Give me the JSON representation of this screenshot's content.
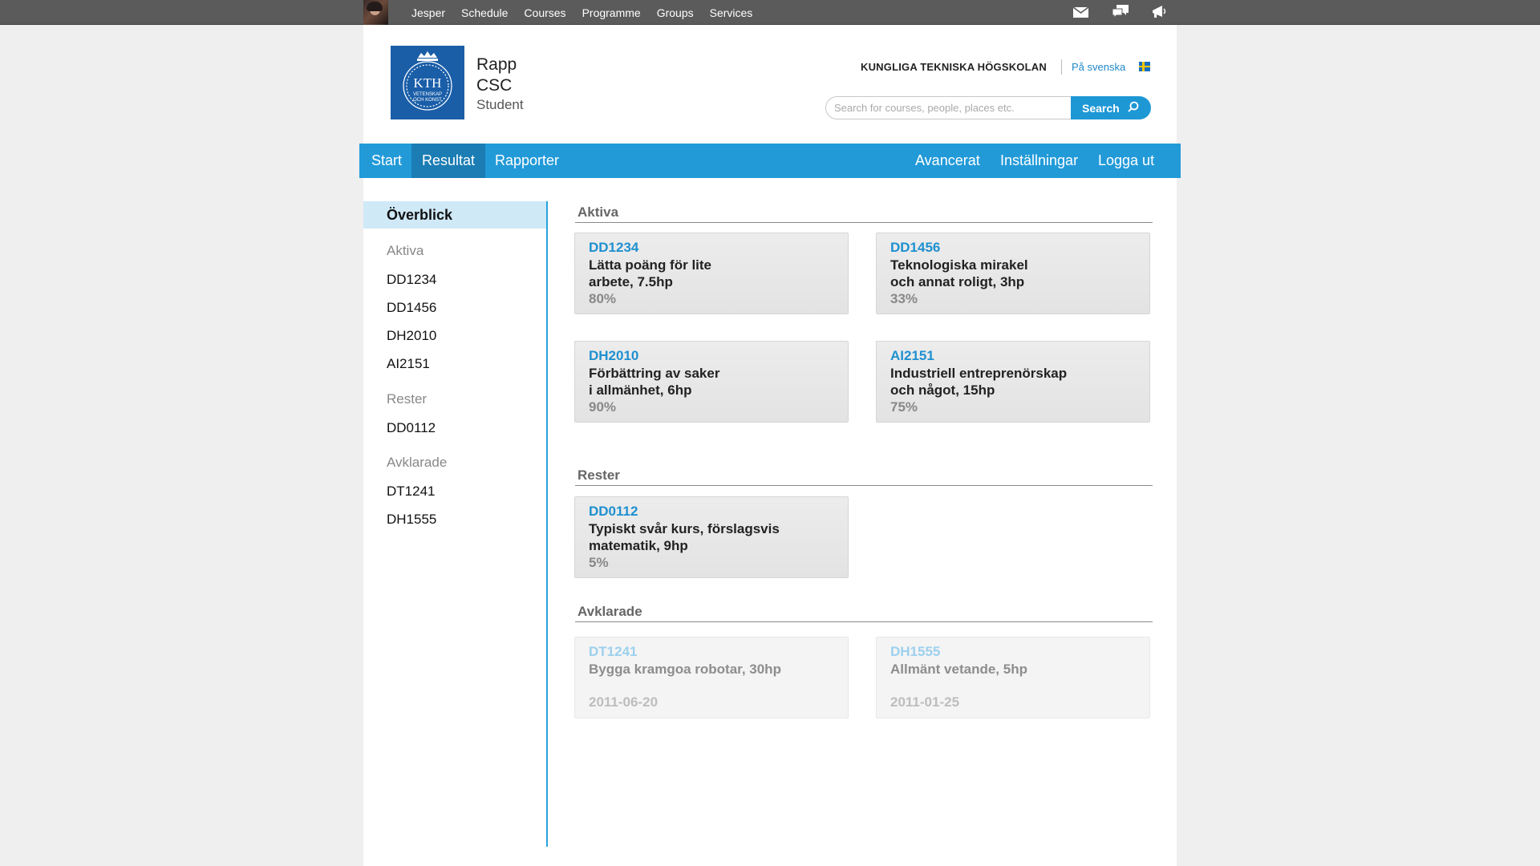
{
  "topbar": {
    "nav": [
      "Jesper",
      "Schedule",
      "Courses",
      "Programme",
      "Groups",
      "Services"
    ],
    "icons": [
      "mail-icon",
      "chat-icon",
      "megaphone-icon"
    ]
  },
  "header": {
    "app_line1": "Rapp",
    "app_line2": "CSC",
    "app_line3": "Student",
    "logo_text_1": "KTH",
    "logo_text_2": "VETENSKAP",
    "logo_text_3": "OCH KONST",
    "university": "KUNGLIGA TEKNISKA HÖGSKOLAN",
    "lang_link": "På svenska",
    "search_placeholder": "Search for courses, people, places etc.",
    "search_button": "Search"
  },
  "nav": {
    "left": [
      "Start",
      "Resultat",
      "Rapporter"
    ],
    "right": [
      "Avancerat",
      "Inställningar",
      "Logga ut"
    ],
    "active": "Resultat"
  },
  "sidebar": {
    "overview": "Överblick",
    "groups": [
      {
        "heading": "Aktiva",
        "items": [
          "DD1234",
          "DD1456",
          "DH2010",
          "AI2151"
        ]
      },
      {
        "heading": "Rester",
        "items": [
          "DD0112"
        ]
      },
      {
        "heading": "Avklarade",
        "items": [
          "DT1241",
          "DH1555"
        ]
      }
    ]
  },
  "main": {
    "sections": [
      {
        "title": "Aktiva",
        "courses": [
          {
            "code": "DD1234",
            "name1": "Lätta poäng för lite",
            "name2": "arbete, 7.5hp",
            "progress": "80%"
          },
          {
            "code": "DD1456",
            "name1": "Teknologiska mirakel",
            "name2": "och annat roligt, 3hp",
            "progress": "33%"
          },
          {
            "code": "DH2010",
            "name1": "Förbättring av saker",
            "name2": "i allmänhet, 6hp",
            "progress": "90%"
          },
          {
            "code": "AI2151",
            "name1": "Industriell entreprenörskap",
            "name2": "och något, 15hp",
            "progress": "75%"
          }
        ]
      },
      {
        "title": "Rester",
        "courses": [
          {
            "code": "DD0112",
            "name1": "Typiskt svår kurs, förslagsvis",
            "name2": "matematik, 9hp",
            "progress": "5%"
          }
        ]
      },
      {
        "title": "Avklarade",
        "courses": [
          {
            "code": "DT1241",
            "name1": "Bygga kramgoa robotar, 30hp",
            "date": "2011-06-20"
          },
          {
            "code": "DH1555",
            "name1": "Allmänt vetande, 5hp",
            "date": "2011-01-25"
          }
        ]
      }
    ]
  },
  "colors": {
    "accent": "#229ad8",
    "accent_dark": "#1b7db4",
    "link": "#1e90d0",
    "topbar": "#5b5b5b",
    "sidebar_active": "#cfe9f7"
  }
}
